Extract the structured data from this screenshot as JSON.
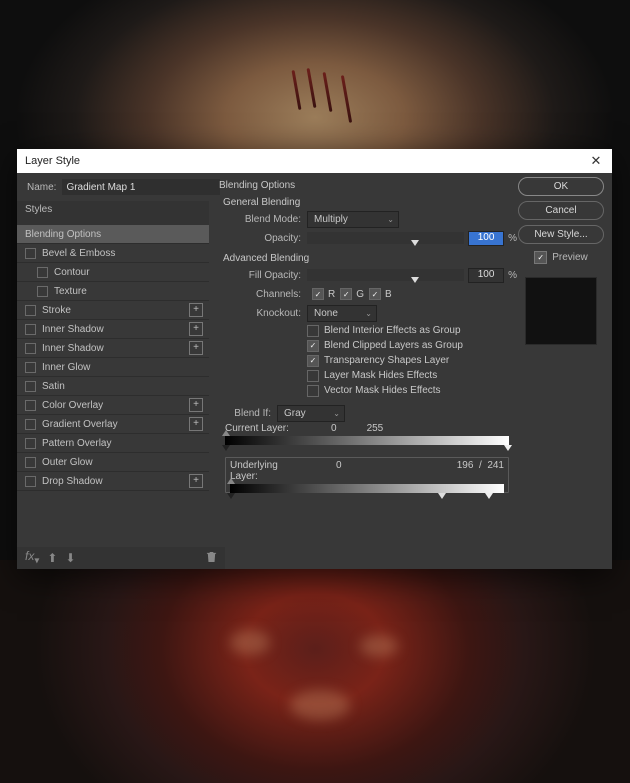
{
  "dialog": {
    "title": "Layer Style",
    "name_label": "Name:",
    "name_value": "Gradient Map 1"
  },
  "sidebar": {
    "header": "Styles",
    "items": [
      {
        "label": "Blending Options",
        "active": true,
        "checkbox": false
      },
      {
        "label": "Bevel & Emboss",
        "checkbox": true,
        "checked": false
      },
      {
        "label": "Contour",
        "sub": true,
        "checkbox": true,
        "checked": false
      },
      {
        "label": "Texture",
        "sub": true,
        "checkbox": true,
        "checked": false
      },
      {
        "label": "Stroke",
        "checkbox": true,
        "checked": false,
        "plus": true
      },
      {
        "label": "Inner Shadow",
        "checkbox": true,
        "checked": false,
        "plus": true
      },
      {
        "label": "Inner Shadow",
        "checkbox": true,
        "checked": false,
        "plus": true
      },
      {
        "label": "Inner Glow",
        "checkbox": true,
        "checked": false
      },
      {
        "label": "Satin",
        "checkbox": true,
        "checked": false
      },
      {
        "label": "Color Overlay",
        "checkbox": true,
        "checked": false,
        "plus": true
      },
      {
        "label": "Gradient Overlay",
        "checkbox": true,
        "checked": false,
        "plus": true
      },
      {
        "label": "Pattern Overlay",
        "checkbox": true,
        "checked": false
      },
      {
        "label": "Outer Glow",
        "checkbox": true,
        "checked": false
      },
      {
        "label": "Drop Shadow",
        "checkbox": true,
        "checked": false,
        "plus": true
      }
    ],
    "footer_fx": "fx"
  },
  "content": {
    "section": "Blending Options",
    "general": {
      "title": "General Blending",
      "blend_mode_label": "Blend Mode:",
      "blend_mode_value": "Multiply",
      "opacity_label": "Opacity:",
      "opacity_value": "100",
      "opacity_unit": "%"
    },
    "advanced": {
      "title": "Advanced Blending",
      "fill_opacity_label": "Fill Opacity:",
      "fill_opacity_value": "100",
      "fill_opacity_unit": "%",
      "channels_label": "Channels:",
      "channel_r": "R",
      "channel_g": "G",
      "channel_b": "B",
      "knockout_label": "Knockout:",
      "knockout_value": "None",
      "checks": [
        {
          "label": "Blend Interior Effects as Group",
          "checked": false
        },
        {
          "label": "Blend Clipped Layers as Group",
          "checked": true
        },
        {
          "label": "Transparency Shapes Layer",
          "checked": true
        },
        {
          "label": "Layer Mask Hides Effects",
          "checked": false
        },
        {
          "label": "Vector Mask Hides Effects",
          "checked": false
        }
      ]
    },
    "blendif": {
      "label": "Blend If:",
      "value": "Gray",
      "current_label": "Current Layer:",
      "current_black": "0",
      "current_white": "255",
      "underlying_label": "Underlying Layer:",
      "underlying_black": "0",
      "underlying_white_a": "196",
      "underlying_sep": "/",
      "underlying_white_b": "241"
    }
  },
  "right": {
    "ok": "OK",
    "cancel": "Cancel",
    "new_style": "New Style...",
    "preview": "Preview"
  }
}
